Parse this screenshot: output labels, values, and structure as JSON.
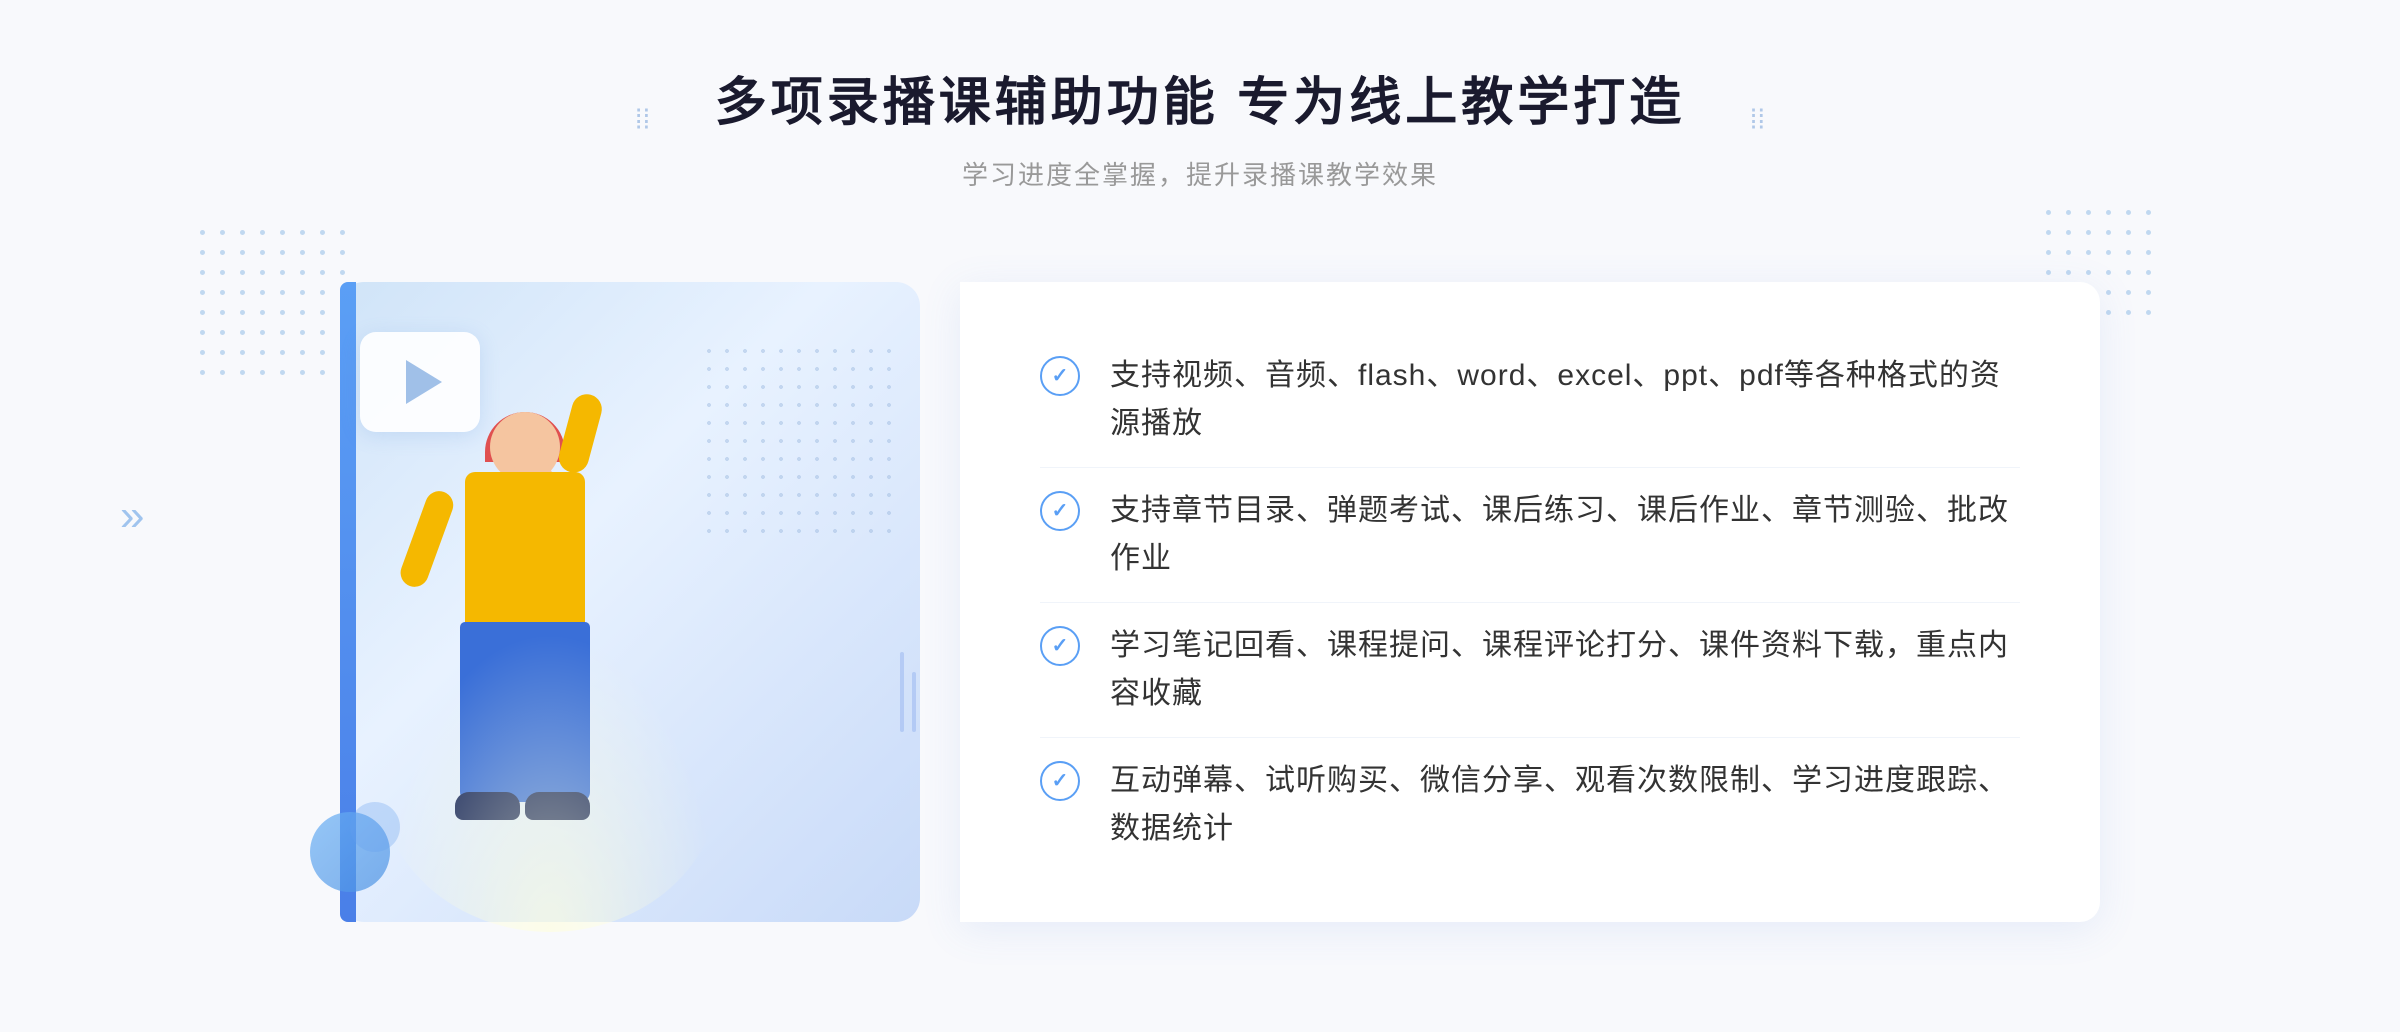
{
  "page": {
    "background_color": "#f8f9fc"
  },
  "header": {
    "title": "多项录播课辅助功能 专为线上教学打造",
    "subtitle": "学习进度全掌握，提升录播课教学效果"
  },
  "features": [
    {
      "id": 1,
      "text": "支持视频、音频、flash、word、excel、ppt、pdf等各种格式的资源播放"
    },
    {
      "id": 2,
      "text": "支持章节目录、弹题考试、课后练习、课后作业、章节测验、批改作业"
    },
    {
      "id": 3,
      "text": "学习笔记回看、课程提问、课程评论打分、课件资料下载，重点内容收藏"
    },
    {
      "id": 4,
      "text": "互动弹幕、试听购买、微信分享、观看次数限制、学习进度跟踪、数据统计"
    }
  ],
  "decorations": {
    "left_arrow": "»",
    "dots_color": "#c5d8f5"
  }
}
